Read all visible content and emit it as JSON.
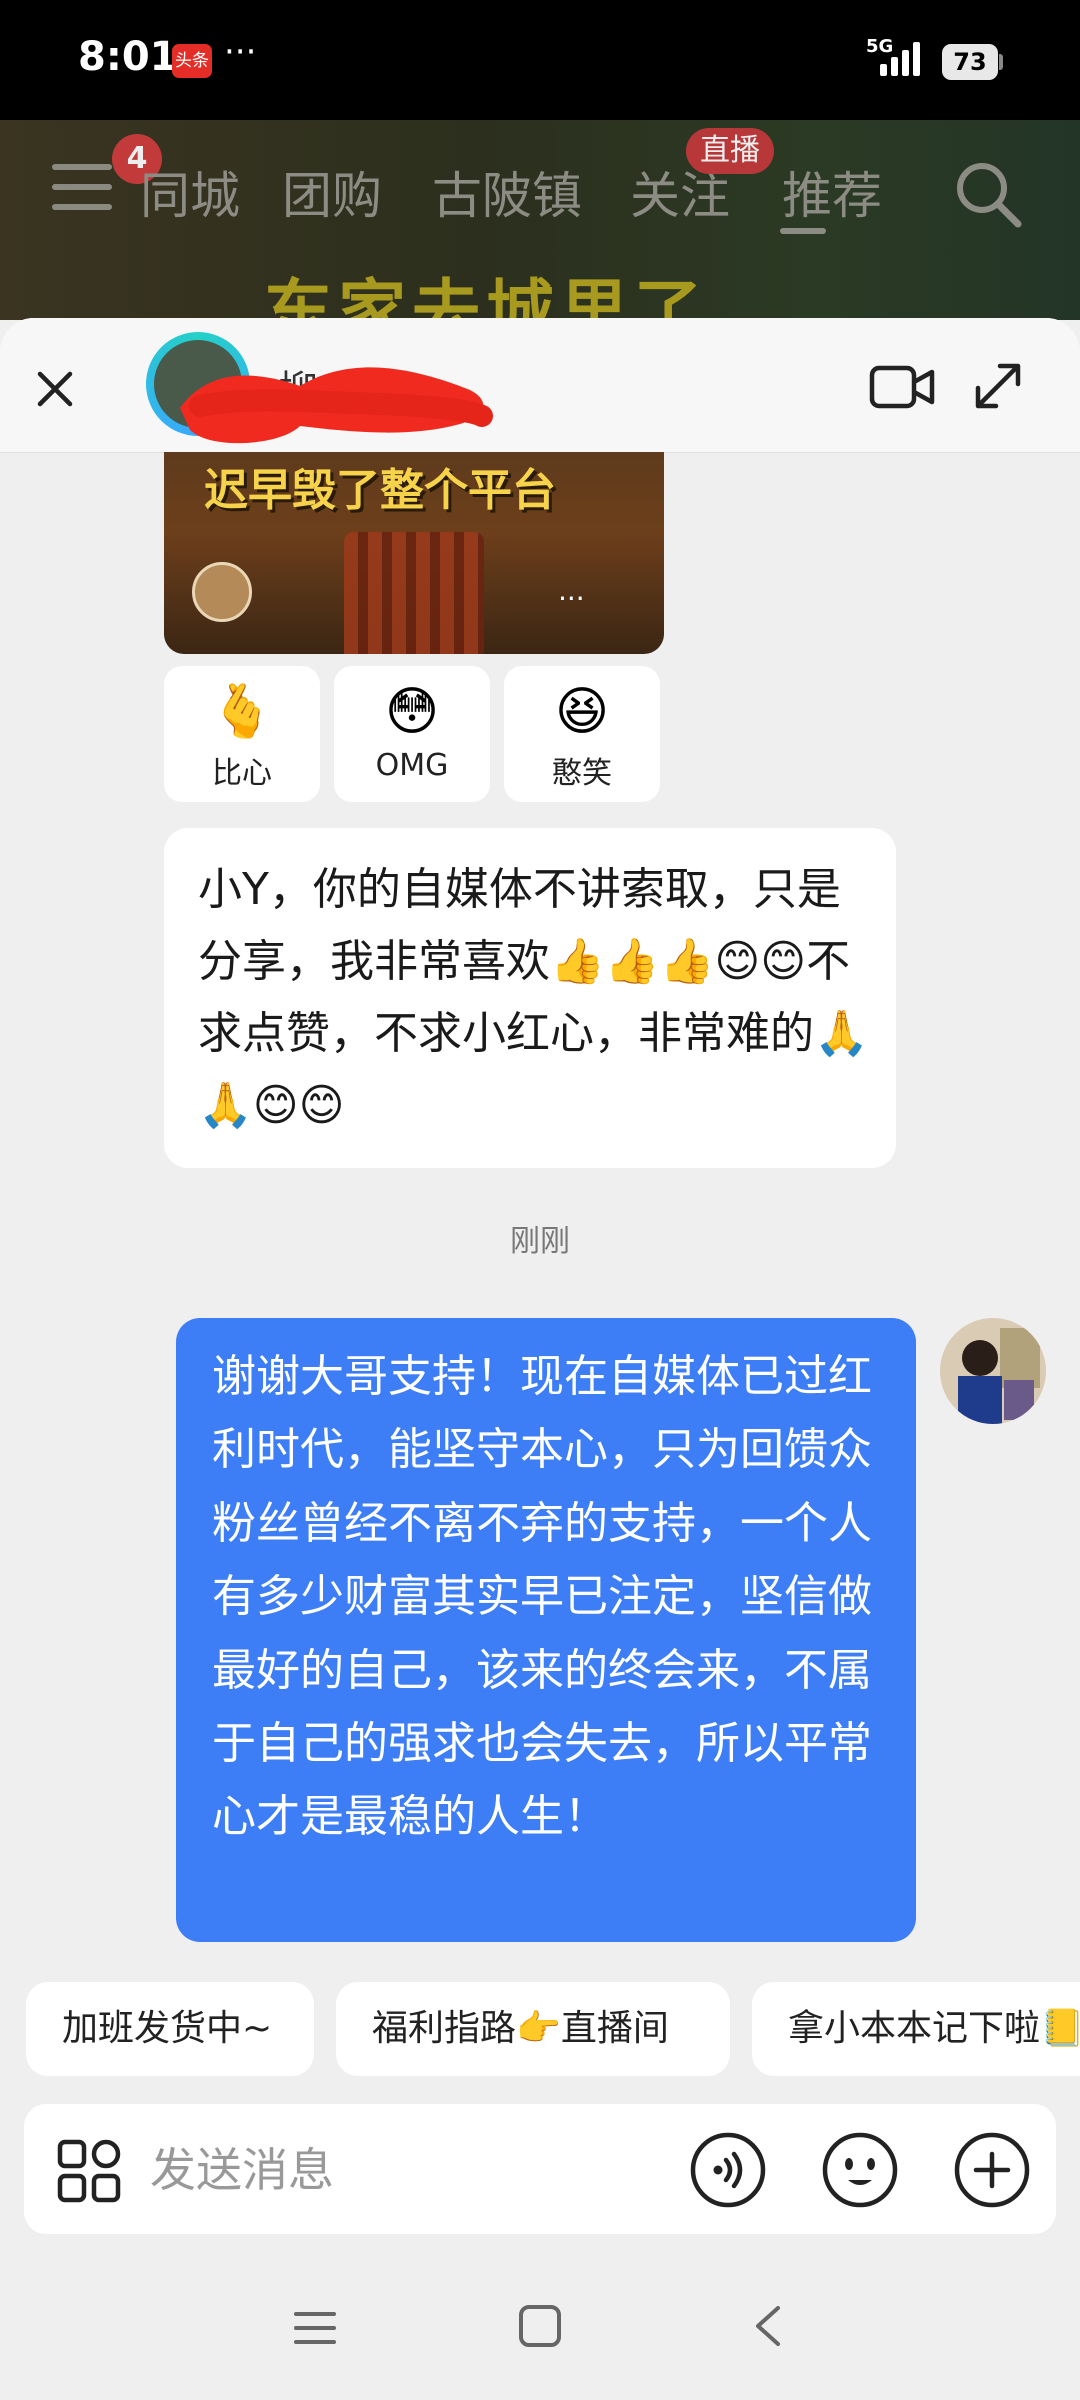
{
  "status_bar": {
    "time": "8:01",
    "notification_badge": "头条",
    "overflow": "···",
    "network": "5G",
    "battery": "73"
  },
  "background_app": {
    "menu_badge": "4",
    "tabs": [
      "同城",
      "团购",
      "古陂镇",
      "关注",
      "推荐"
    ],
    "live_badge": "直播",
    "headline": "东家去城里了"
  },
  "chat": {
    "contact_name": "柳",
    "video_card": {
      "overlay_text": "迟早毁了整个平台",
      "more": "···"
    },
    "reactions": [
      {
        "emoji": "🫰",
        "label": "比心"
      },
      {
        "emoji": "😳",
        "label": "OMG"
      },
      {
        "emoji": "😆",
        "label": "憨笑"
      }
    ],
    "incoming_message": "小Y，你的自媒体不讲索取，只是分享，我非常喜欢👍👍👍😊😊不求点赞，不求小红心，非常难的🙏🙏😊😊",
    "timestamp": "刚刚",
    "outgoing_message": "谢谢大哥支持！现在自媒体已过红利时代，能坚守本心，只为回馈众粉丝曾经不离不弃的支持，一个人有多少财富其实早已注定，坚信做最好的自己，该来的终会来，不属于自己的强求也会失去，所以平常心才是最稳的人生！"
  },
  "quick_replies": [
    "加班发货中~",
    "福利指路👉直播间",
    "拿小本本记下啦📒"
  ],
  "input": {
    "placeholder": "发送消息",
    "value": ""
  },
  "colors": {
    "outgoing_bubble": "#3d7ef6",
    "incoming_bubble": "#ffffff",
    "background": "#efefef",
    "badge_red": "#e52d27"
  },
  "icons": [
    "close-icon",
    "video-call-icon",
    "expand-icon",
    "apps-icon",
    "voice-icon",
    "emoji-icon",
    "plus-icon",
    "nav-menu-icon",
    "nav-home-icon",
    "nav-back-icon"
  ]
}
